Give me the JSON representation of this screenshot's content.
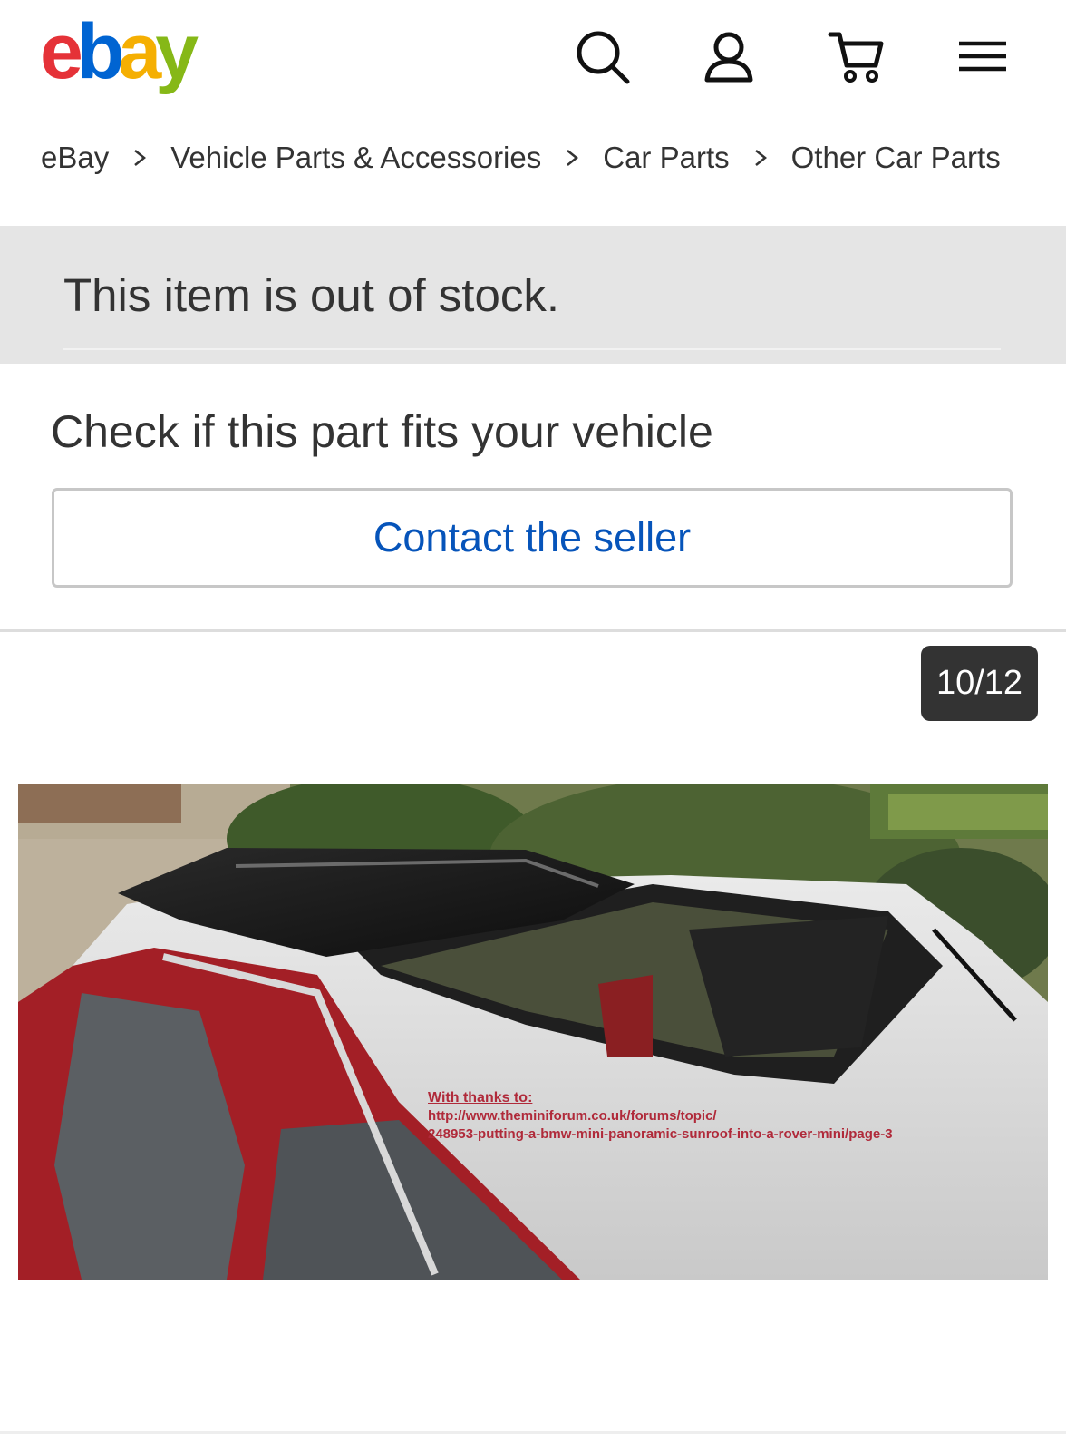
{
  "header": {
    "logo": {
      "e": "e",
      "b": "b",
      "a": "a",
      "y": "y"
    },
    "icons": [
      "search-icon",
      "account-icon",
      "cart-icon",
      "menu-icon"
    ]
  },
  "breadcrumb": [
    "eBay",
    "Vehicle Parts & Accessories",
    "Car Parts",
    "Other Car Parts"
  ],
  "status": {
    "message": "This item is out of stock."
  },
  "fitment": {
    "heading": "Check if this part fits your vehicle",
    "contact_label": "Contact the seller"
  },
  "gallery": {
    "counter": "10/12",
    "caption_line1": "With thanks to:",
    "caption_line2": "http://www.theminiforum.co.uk/forums/topic/",
    "caption_line3": "248953-putting-a-bmw-mini-panoramic-sunroof-into-a-rover-mini/page-3"
  },
  "colors": {
    "ebay_red": "#e53238",
    "ebay_blue": "#0064d2",
    "ebay_yellow": "#f5af02",
    "ebay_green": "#86b817",
    "link_blue": "#0654ba"
  }
}
